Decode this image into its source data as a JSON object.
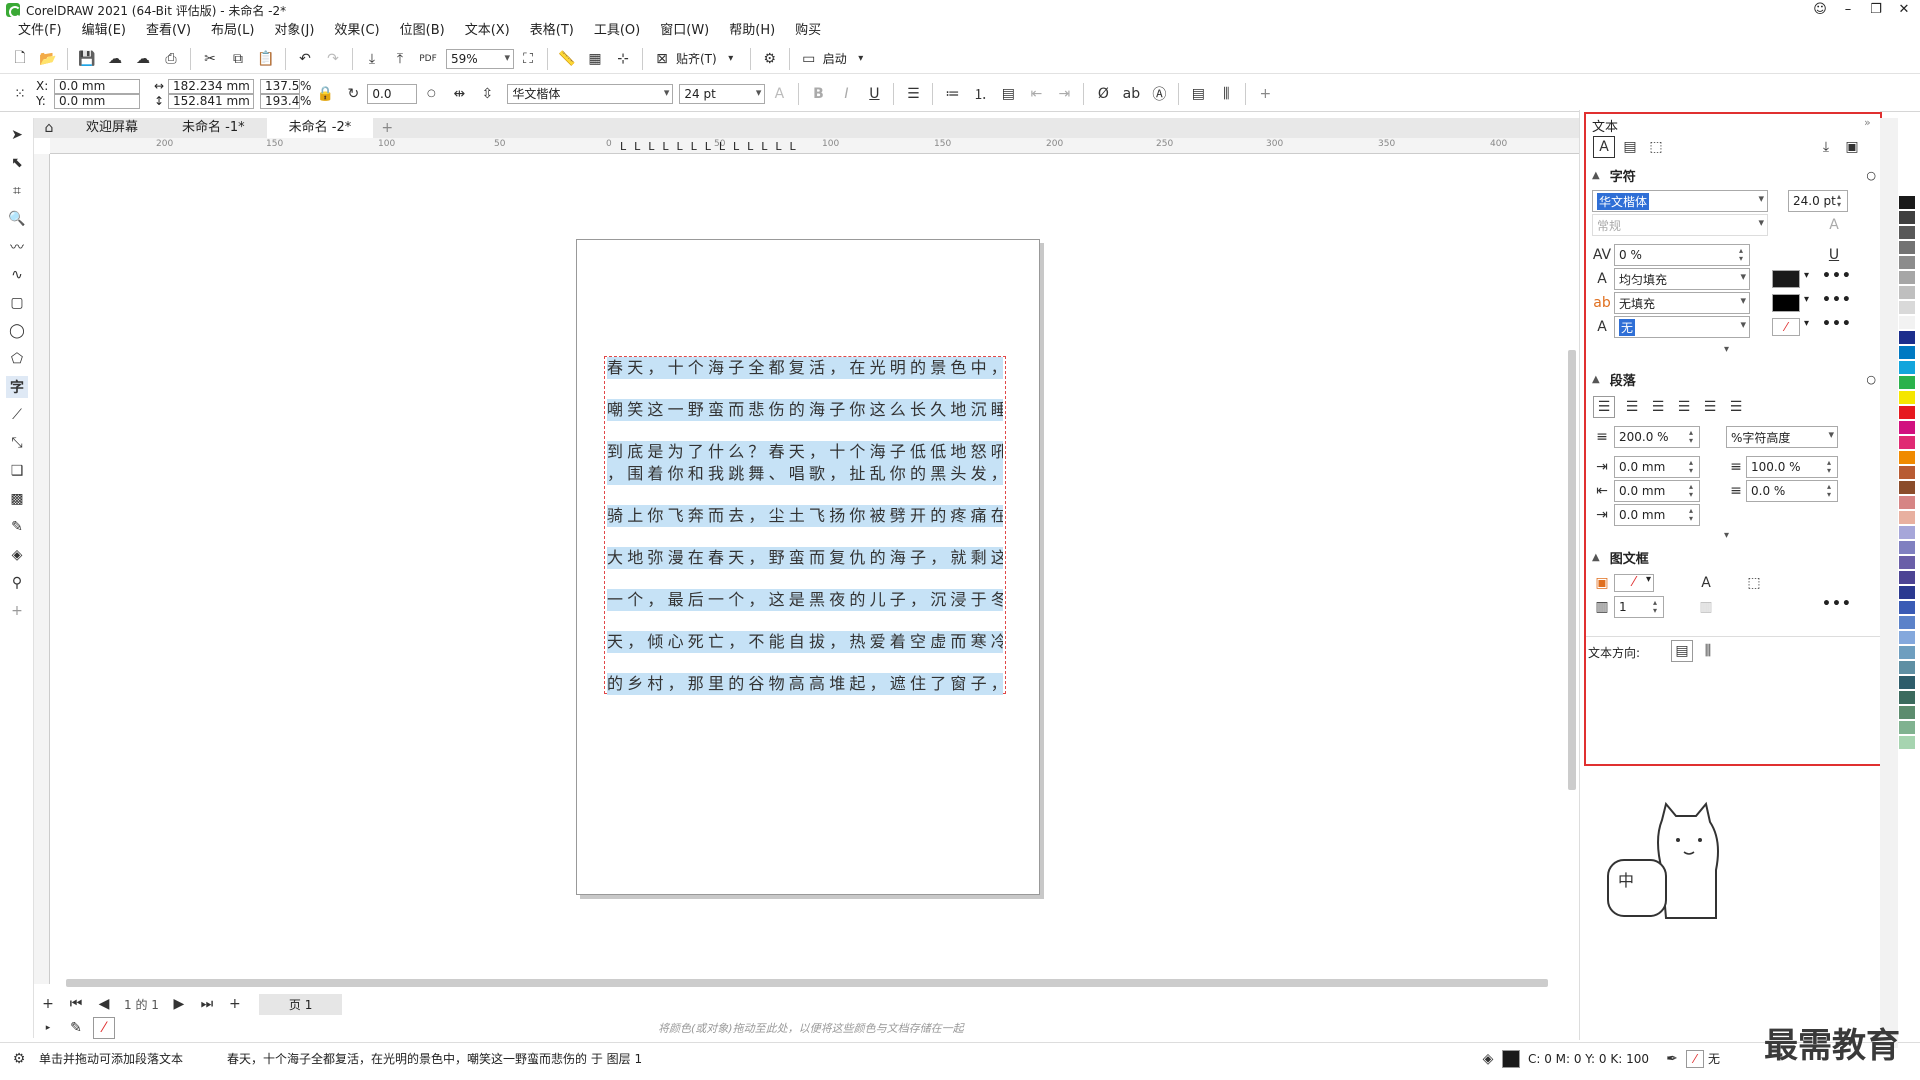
{
  "window": {
    "title": "CorelDRAW 2021 (64-Bit 评估版) - 未命名 -2*"
  },
  "menu": [
    "文件(F)",
    "编辑(E)",
    "查看(V)",
    "布局(L)",
    "对象(J)",
    "效果(C)",
    "位图(B)",
    "文本(X)",
    "表格(T)",
    "工具(O)",
    "窗口(W)",
    "帮助(H)",
    "购买"
  ],
  "toolbar": {
    "zoom": "59%",
    "snap_label": "贴齐(T)",
    "launch_label": "启动"
  },
  "propbar": {
    "x_label": "X:",
    "x": "0.0 mm",
    "y_label": "Y:",
    "y": "0.0 mm",
    "w": "182.234 mm",
    "h": "152.841 mm",
    "sx": "137.5",
    "sy": "193.4",
    "pct": "%",
    "rotation": "0.0",
    "font": "华文楷体",
    "size": "24 pt"
  },
  "tabs": [
    "欢迎屏幕",
    "未命名 -1*",
    "未命名 -2*"
  ],
  "ruler_ticks": [
    "200",
    "150",
    "100",
    "50",
    "0",
    "50",
    "100",
    "150",
    "200",
    "250",
    "300",
    "350",
    "400"
  ],
  "text_lines": [
    "春天，十个海子全都复活，在光明的景色中，",
    "嘲笑这一野蛮而悲伤的海子你这么长久地沉睡",
    "到底是为了什么？春天，十个海子低低地怒吼",
    "，围着你和我跳舞、唱歌，扯乱你的黑头发，",
    "骑上你飞奔而去，尘土飞扬你被劈开的疼痛在",
    "大地弥漫在春天，野蛮而复仇的海子，就剩这",
    "一个，最后一个，这是黑夜的儿子，沉浸于冬",
    "天，倾心死亡，不能自拔，热爱着空虚而寒冷",
    "的乡村，那里的谷物高高堆起，遮住了窗子，"
  ],
  "pagenav": {
    "page_of": "1 的 1",
    "page_tab": "页 1"
  },
  "color_hint": "将颜色(或对象)拖动至此处，以便将这些颜色与文档存储在一起",
  "status": {
    "hint": "单击并拖动可添加段落文本",
    "info": "春天，十个海子全都复活，在光明的景色中，嘲笑这一野蛮而悲伤的 于 图层 1",
    "cmyk": "C: 0 M: 0 Y: 0 K: 100",
    "fill_none": "无"
  },
  "docker": {
    "title": "文本",
    "char_section": "字符",
    "font": "华文楷体",
    "font_size": "24.0 pt",
    "style": "常规",
    "kerning": "0 %",
    "fill_type": "均匀填充",
    "bg_fill": "无填充",
    "outline": "无",
    "para_section": "段落",
    "line_spacing": "200.0 %",
    "spacing_unit": "%字符高度",
    "indent1": "0.0 mm",
    "indent2": "0.0 mm",
    "indent3": "0.0 mm",
    "char_spacing": "100.0 %",
    "word_spacing": "0.0 %",
    "frame_section": "图文框",
    "columns": "1",
    "text_dir_label": "文本方向:"
  },
  "colors": {
    "accent_red": "#e03030",
    "selection": "#c6e2f6"
  },
  "palette": [
    "#ffffff",
    "#1a1a1a",
    "#404040",
    "#595959",
    "#737373",
    "#8c8c8c",
    "#a6a6a6",
    "#bfbfbf",
    "#d9d9d9",
    "#f2f2f2",
    "#1c2e8c",
    "#0079c2",
    "#12a5dc",
    "#2bb24c",
    "#f5e600",
    "#e6191f",
    "#d1117f",
    "#e02a73",
    "#f08a00",
    "#b85b33",
    "#8b4d2b",
    "#d68585",
    "#e8b0a0",
    "#a6a6d9",
    "#8080c0",
    "#6a5fa8",
    "#4d4494",
    "#2b3990",
    "#3a5bb5",
    "#5b82c9",
    "#84a8dc",
    "#6e9ebf",
    "#5f8fa3",
    "#2e5d6b",
    "#3b6b5e",
    "#5c8c6e",
    "#80b290",
    "#a6d4b0"
  ],
  "watermark": "最需教育"
}
